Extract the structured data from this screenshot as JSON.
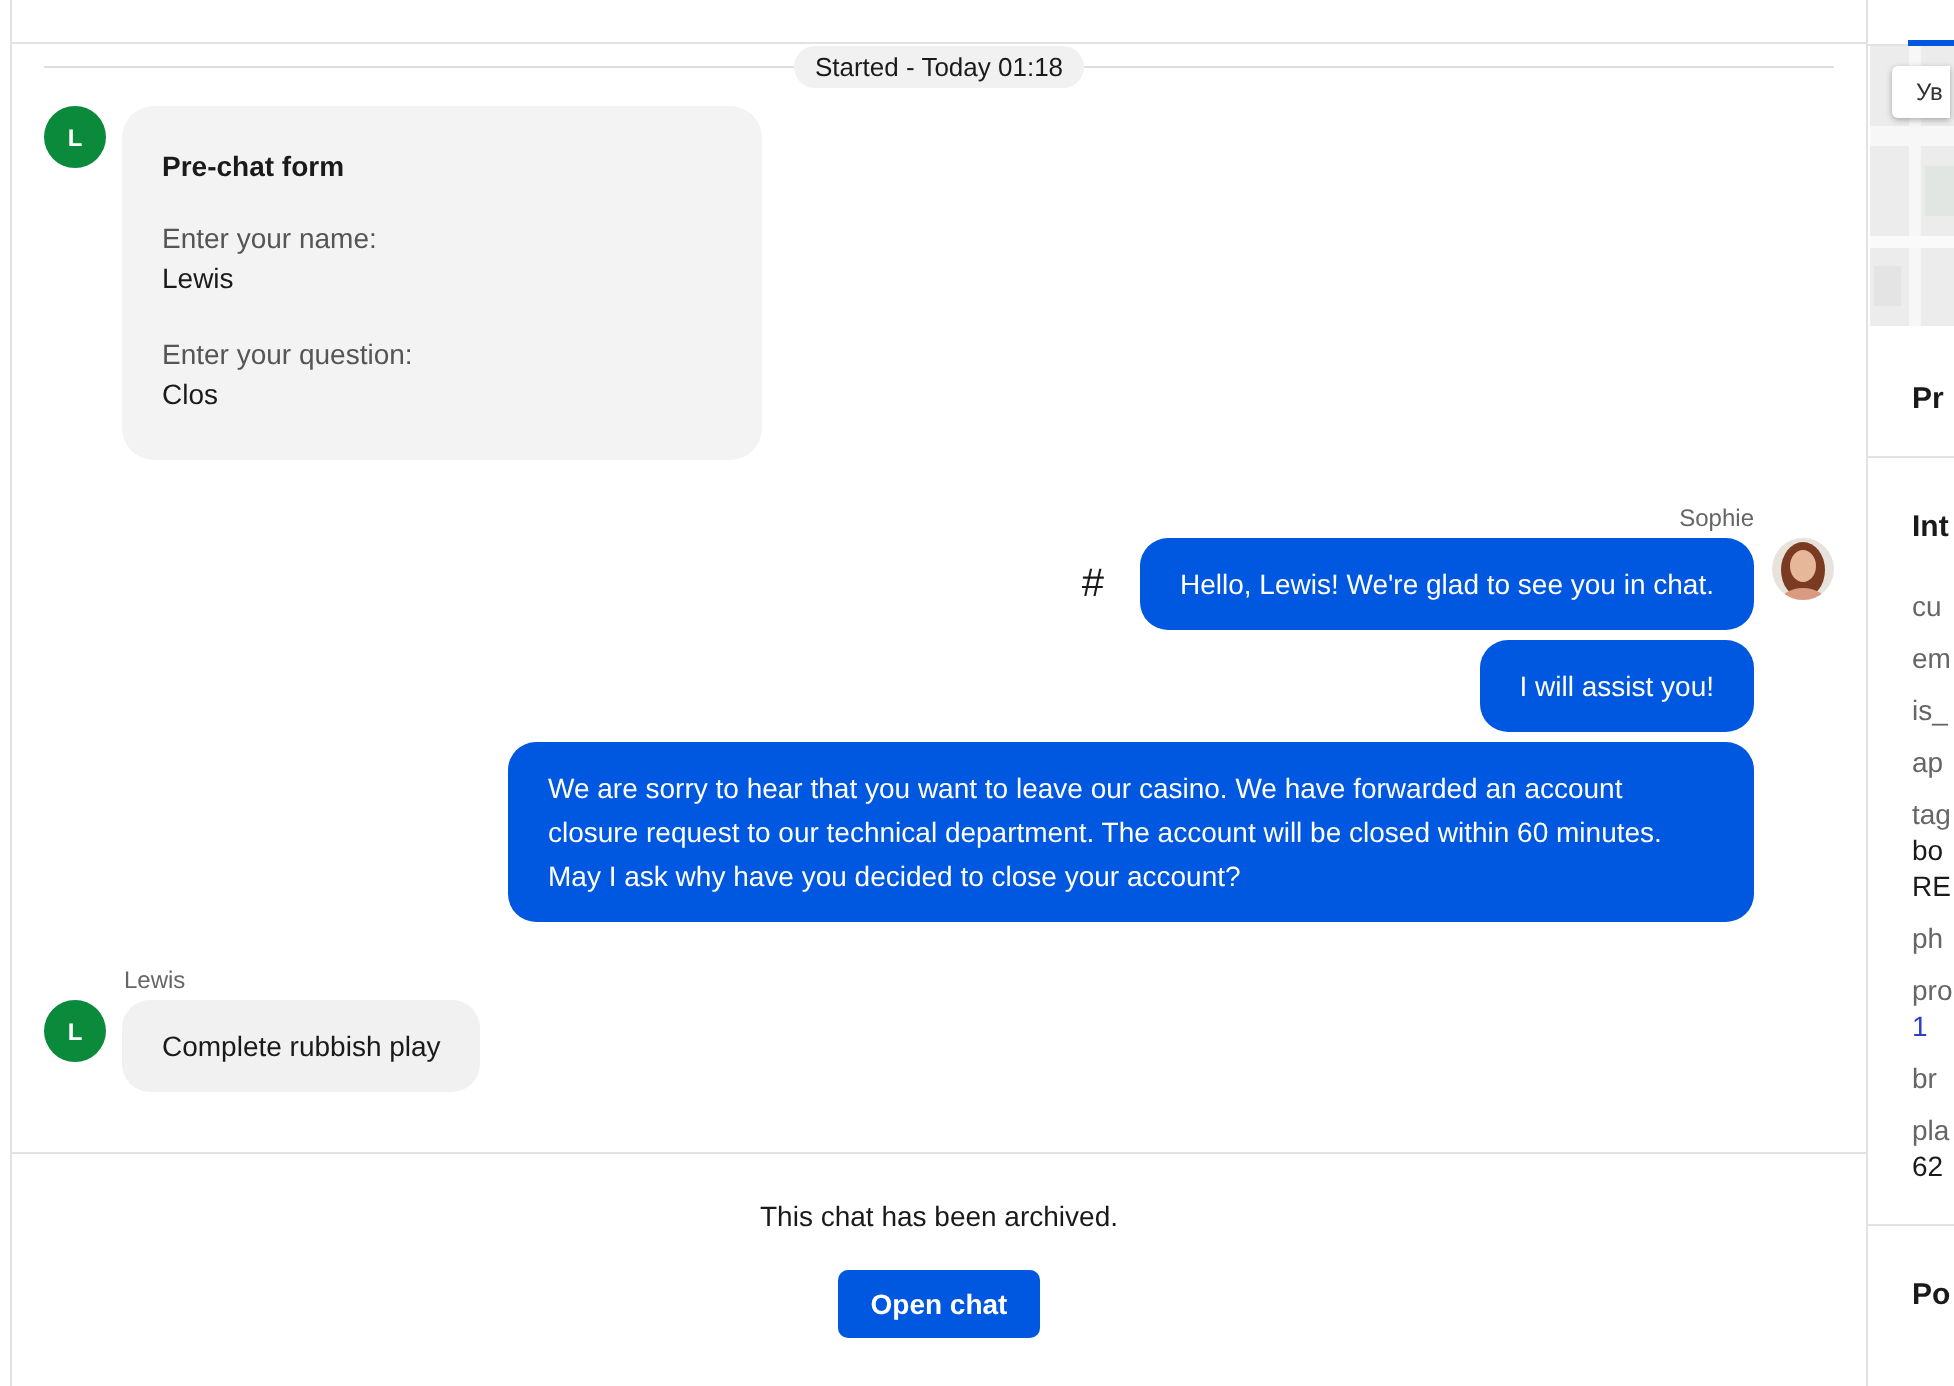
{
  "chat": {
    "started_label": "Started - Today 01:18",
    "form": {
      "avatar_letter": "L",
      "title": "Pre-chat form",
      "fields": [
        {
          "label": "Enter your name:",
          "value": "Lewis"
        },
        {
          "label": "Enter your question:",
          "value": "Clos"
        }
      ]
    },
    "messages": [
      {
        "kind": "agent",
        "author": "Sophie",
        "marker": "#",
        "texts": [
          "Hello, Lewis! We're glad to see you in chat.",
          "I will assist you!",
          "We are sorry to hear that you want to leave our casino. We have forwarded an account closure request to our technical department. The account will be closed within 60 minutes. May I ask why have you decided to close your account?"
        ]
      },
      {
        "kind": "visitor",
        "author": "Lewis",
        "avatar_letter": "L",
        "texts": [
          "Complete rubbish play"
        ]
      }
    ],
    "archived_notice": "This chat has been archived.",
    "open_button": "Open chat"
  },
  "sidebar": {
    "map": {
      "kind": "picture",
      "zoom_button": "Ув"
    },
    "sections": [
      {
        "title": "Pr"
      },
      {
        "title": "Int",
        "rows": [
          {
            "key": "cu"
          },
          {
            "key": "em"
          },
          {
            "key": "is_"
          },
          {
            "key": "ap"
          },
          {
            "key": "tag",
            "value": "bo",
            "value_2": "RE"
          },
          {
            "key": "ph"
          },
          {
            "key": "pro",
            "value": "1",
            "link": true
          },
          {
            "key": "br"
          },
          {
            "key": "pla",
            "value": "62"
          }
        ]
      },
      {
        "title": "Po"
      }
    ]
  }
}
